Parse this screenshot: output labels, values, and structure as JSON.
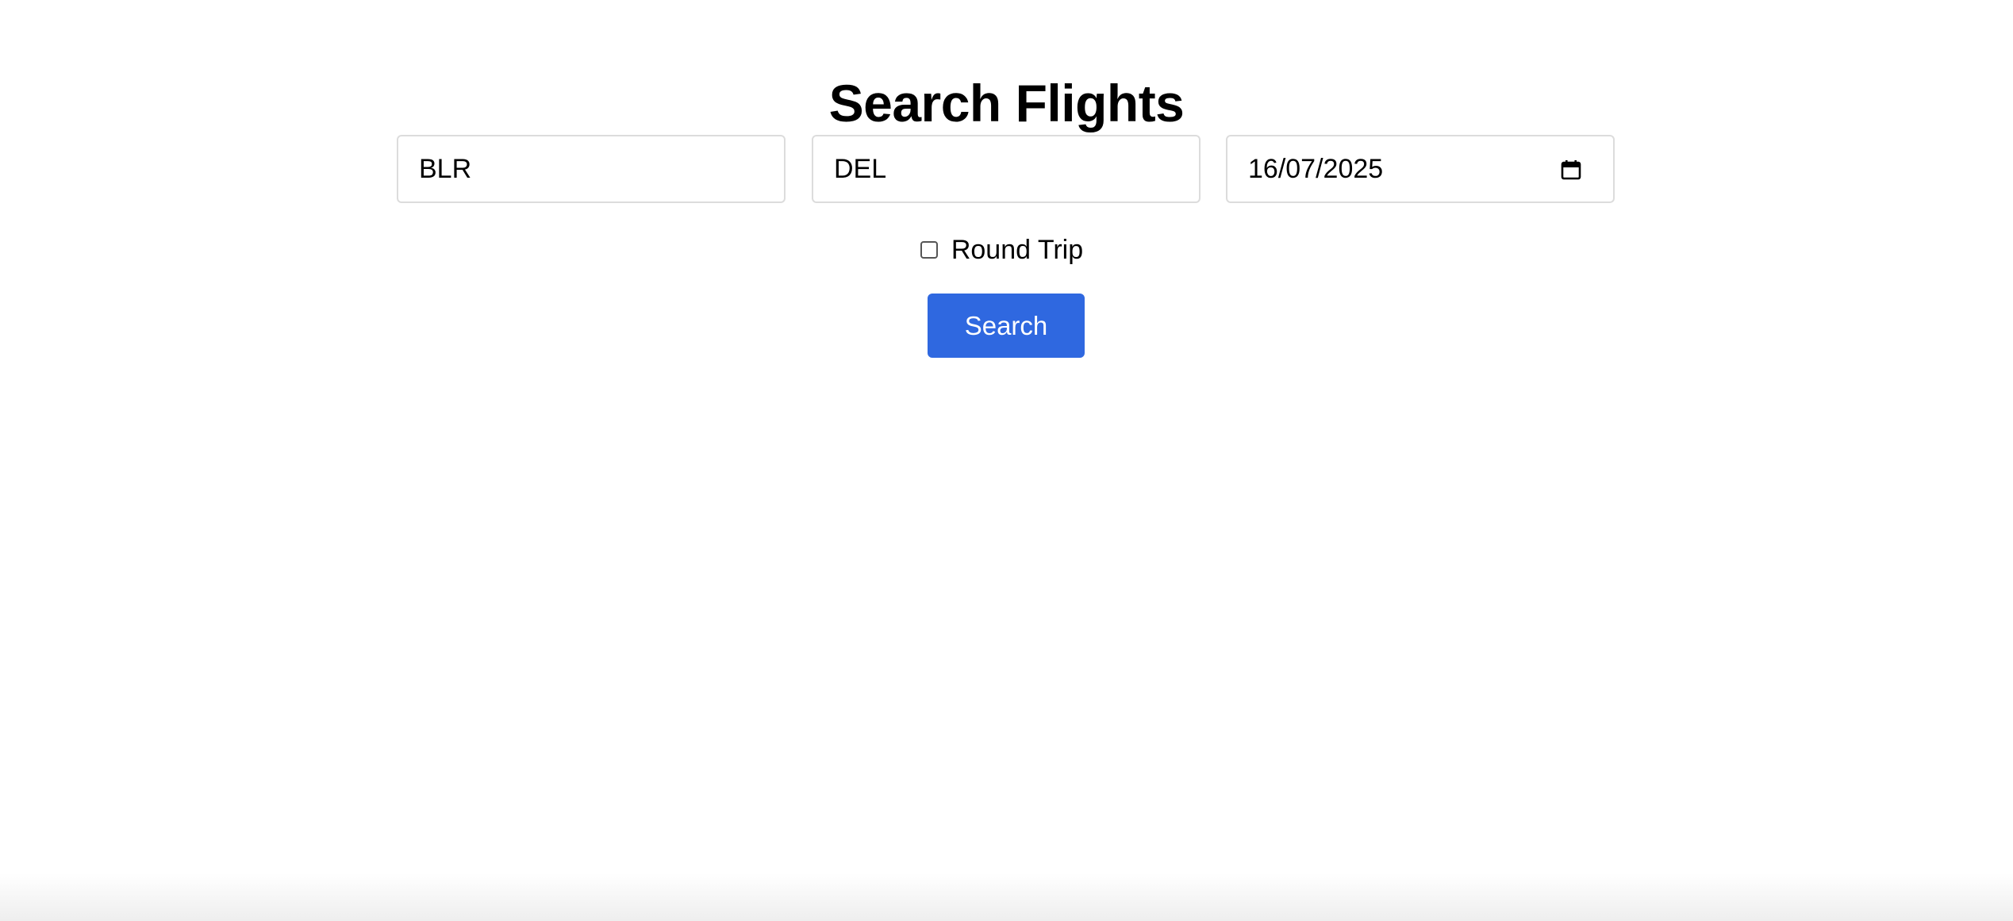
{
  "page": {
    "title": "Search Flights"
  },
  "form": {
    "from_value": "BLR",
    "to_value": "DEL",
    "date_value": "16/07/2025",
    "round_trip_label": "Round Trip",
    "round_trip_checked": false,
    "search_label": "Search"
  },
  "icons": {
    "date_picker": "calendar-icon"
  },
  "colors": {
    "button": "#2f68e0",
    "button_text": "#ffffff",
    "input_border": "#dcdcdc"
  }
}
